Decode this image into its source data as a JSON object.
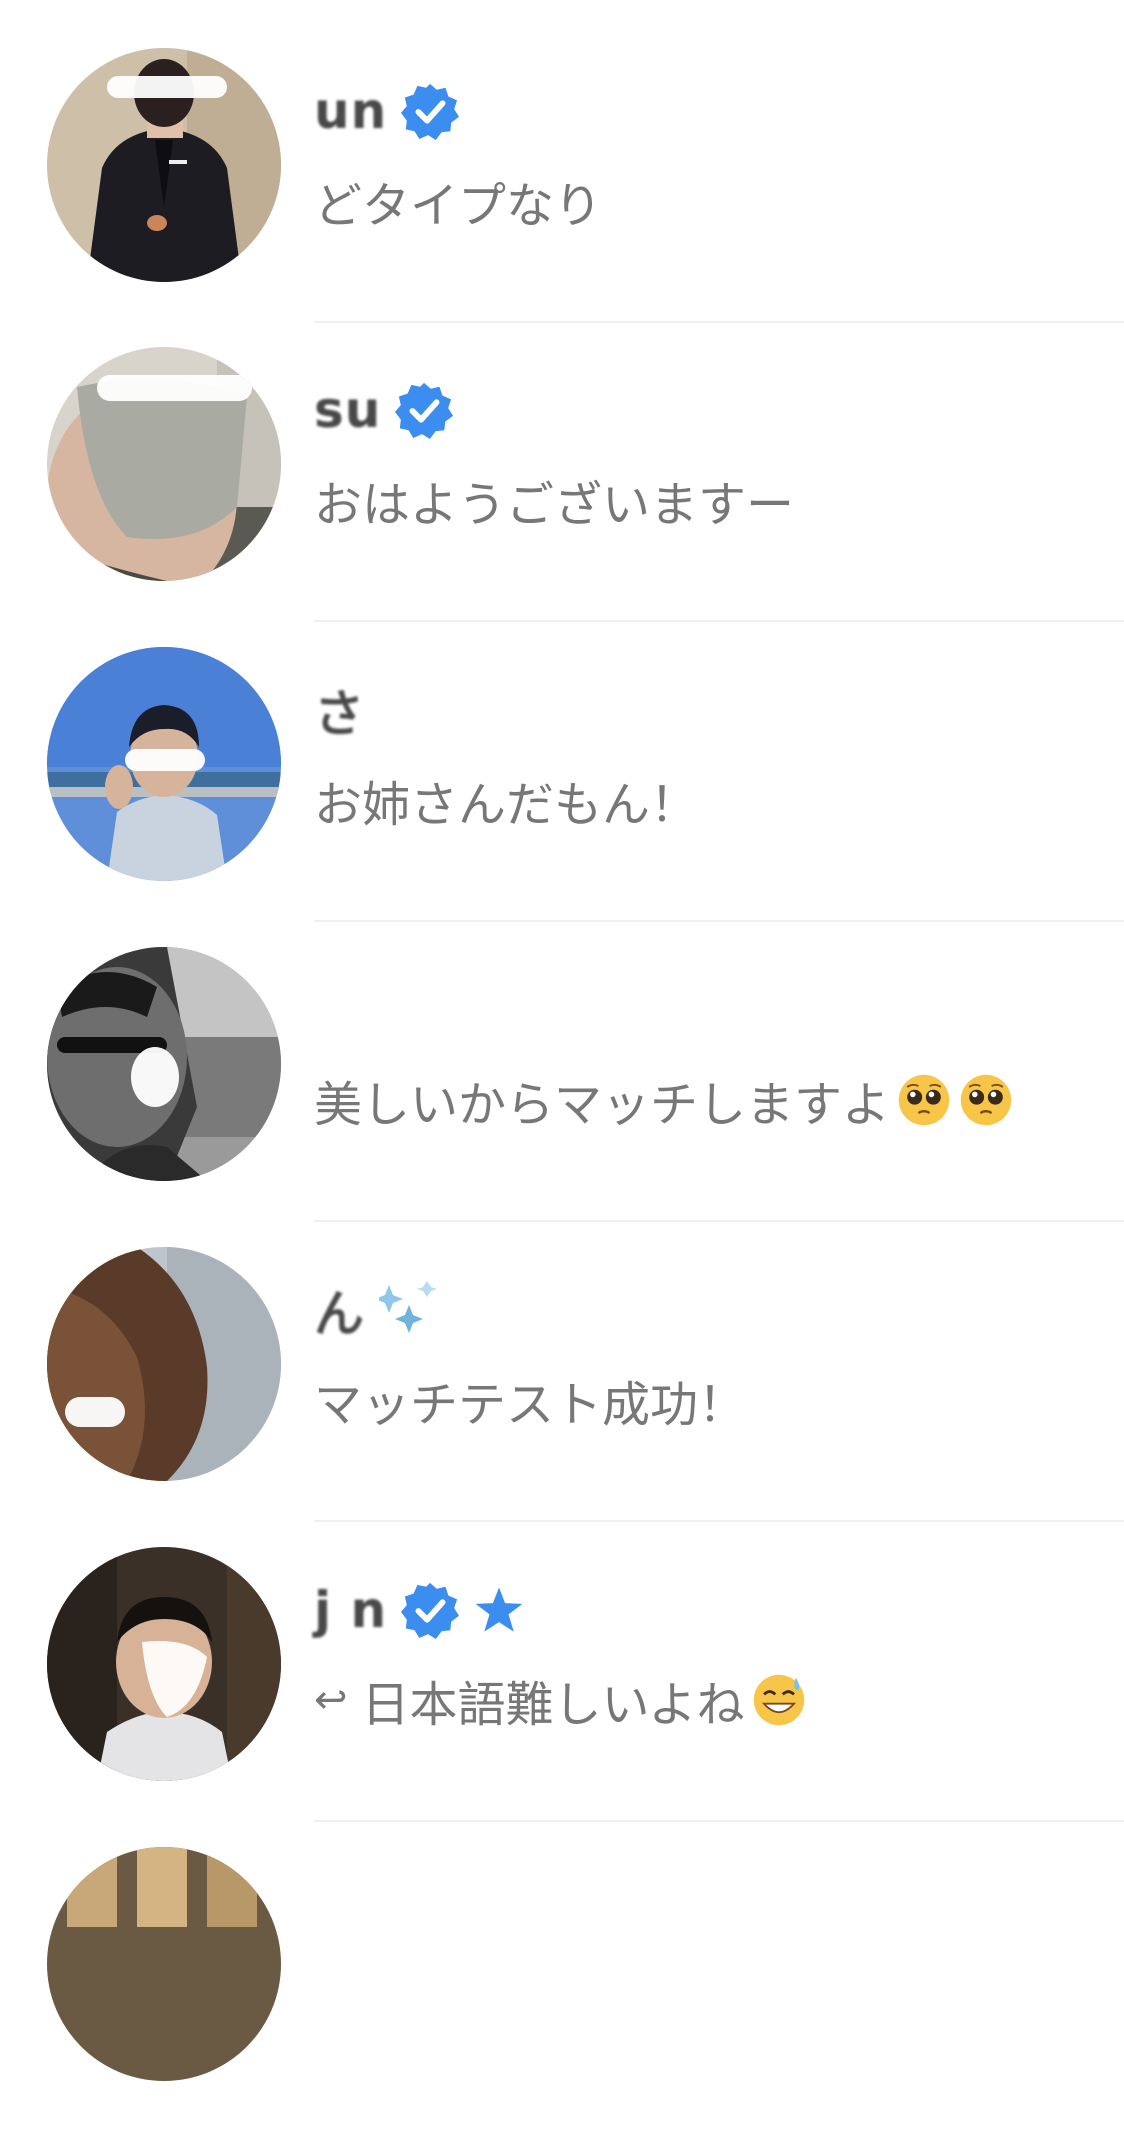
{
  "conversations": [
    {
      "name": "un",
      "verified": true,
      "message": "どタイプなり",
      "avatar_icon": "avatar-man-black-suit"
    },
    {
      "name": "su",
      "verified": true,
      "message": "おはようございますー",
      "avatar_icon": "avatar-man-grey-mask"
    },
    {
      "name": "さ",
      "verified": false,
      "message": "お姉さんだもん！",
      "avatar_icon": "avatar-man-seaside"
    },
    {
      "name": "",
      "verified": false,
      "message": "美しいからマッチしますよ",
      "emojis": [
        "pleading-face-emoji",
        "pleading-face-emoji"
      ],
      "avatar_icon": "avatar-man-sunglasses-monochrome"
    },
    {
      "name": "ん",
      "verified": false,
      "sparkle": true,
      "message": "マッチテスト成功！",
      "avatar_icon": "avatar-partial-face-sea"
    },
    {
      "name": "j n",
      "verified": true,
      "starred": true,
      "reply": true,
      "reply_symbol": "↩",
      "message": "日本語難しいよね",
      "emojis": [
        "grinning-sweat-emoji"
      ],
      "avatar_icon": "avatar-man-white-shirt"
    }
  ],
  "colors": {
    "verified_blue": "#3b8ef0",
    "message_grey": "#777777",
    "divider": "#efefef"
  }
}
